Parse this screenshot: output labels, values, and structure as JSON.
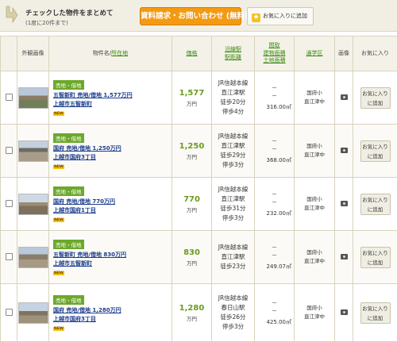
{
  "header": {
    "check_title": "チェックした物件をまとめて",
    "check_subtitle": "(1度に20件まで)",
    "request_button": "資料請求・お問い合わせ (無料)",
    "favorite_button": "お気に入りに追加",
    "colors": {
      "request_button": "#f39a12",
      "price": "#6a9a1e",
      "tag": "#6ca82b",
      "link": "#1a3c8d"
    }
  },
  "columns": {
    "image": "外観画像",
    "name_prefix": "物件名/",
    "name_link": "所在地",
    "price": "価格",
    "station_line1": "沿線駅",
    "station_line2": "駅距離",
    "area_line1": "間取",
    "area_line2": "建物面積",
    "area_line3": "土地面積",
    "school": "通学区",
    "photo": "画像",
    "favorite": "お気に入り"
  },
  "rows": [
    {
      "tag": "売地・借地",
      "title": "五智新町 売地/借地 1,577万円",
      "address": "上越市五智新町",
      "new_badge": "NEW",
      "price": "1,577",
      "price_unit": "万円",
      "station": [
        "JR信越本線",
        "直江津駅",
        "徒歩20分",
        "停歩4分"
      ],
      "area_dash": "－",
      "area_dash2": "－",
      "land_area": "316.00㎡",
      "school": [
        "国府小",
        "直江津中"
      ],
      "fav_line1": "お気に入り",
      "fav_line2": "に追加"
    },
    {
      "tag": "売地・借地",
      "title": "国府 売地/借地 1,250万円",
      "address": "上越市国府3丁目",
      "new_badge": "NEW",
      "price": "1,250",
      "price_unit": "万円",
      "station": [
        "JR信越本線",
        "直江津駅",
        "徒歩29分",
        "停歩3分"
      ],
      "area_dash": "－",
      "area_dash2": "－",
      "land_area": "368.00㎡",
      "school": [
        "国府小",
        "直江津中"
      ],
      "fav_line1": "お気に入り",
      "fav_line2": "に追加"
    },
    {
      "tag": "売地・借地",
      "title": "国府 売地/借地 770万円",
      "address": "上越市国府1丁目",
      "new_badge": "NEW",
      "price": "770",
      "price_unit": "万円",
      "station": [
        "JR信越本線",
        "直江津駅",
        "徒歩31分",
        "停歩3分"
      ],
      "area_dash": "－",
      "area_dash2": "－",
      "land_area": "232.00㎡",
      "school": [
        "国府小",
        "直江津中"
      ],
      "fav_line1": "お気に入り",
      "fav_line2": "に追加"
    },
    {
      "tag": "売地・借地",
      "title": "五智新町 売地/借地 830万円",
      "address": "上越市五智新町",
      "new_badge": "NEW",
      "price": "830",
      "price_unit": "万円",
      "station": [
        "JR信越本線",
        "直江津駅",
        "徒歩23分",
        ""
      ],
      "area_dash": "－",
      "area_dash2": "－",
      "land_area": "249.07㎡",
      "school": [
        "国府小",
        "直江津中"
      ],
      "fav_line1": "お気に入り",
      "fav_line2": "に追加"
    },
    {
      "tag": "売地・借地",
      "title": "国府 売地/借地 1,280万円",
      "address": "上越市国府3丁目",
      "new_badge": "NEW",
      "price": "1,280",
      "price_unit": "万円",
      "station": [
        "JR信越本線",
        "春日山駅",
        "徒歩26分",
        "停歩3分"
      ],
      "area_dash": "－",
      "area_dash2": "－",
      "land_area": "425.00㎡",
      "school": [
        "国府小",
        "直江津中"
      ],
      "fav_line1": "お気に入り",
      "fav_line2": "に追加"
    }
  ]
}
